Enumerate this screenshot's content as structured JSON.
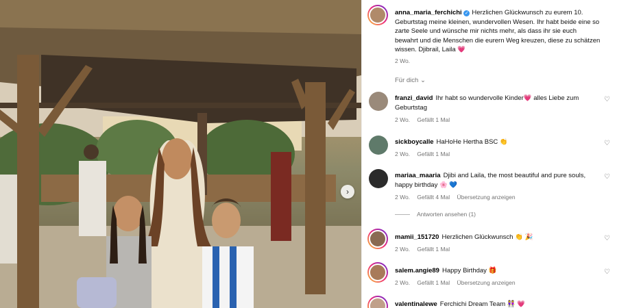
{
  "post": {
    "author": "anna_maria_ferchichi",
    "caption": "Herzlichen Glückwunsch zu eurem 10. Geburtstag meine kleinen, wundervollen Wesen. Ihr habt beide eine so zarte Seele und wünsche mir nichts mehr, als dass ihr sie euch bewahrt und die Menschen die eurern Weg kreuzen, diese zu schätzen wissen. Djibrail, Laila 💗",
    "time": "2 Wo."
  },
  "sort_label": "Für dich",
  "sort_chevron": "⌄",
  "view_replies": "Antworten ansehen (1)",
  "comments": [
    {
      "user": "franzi_david",
      "text": "Ihr habt so wundervolle Kinder💗  alles Liebe zum Geburtstag",
      "time": "2 Wo.",
      "likes": "Gefällt 1 Mal",
      "translate": ""
    },
    {
      "user": "sickboycalle",
      "text": "HaHoHe Hertha BSC 👏",
      "time": "2 Wo.",
      "likes": "Gefällt 1 Mal",
      "translate": ""
    },
    {
      "user": "mariaa_maaria",
      "text": "Djibi and Laila, the most beautiful and pure souls, happy birthday 🌸 💙",
      "time": "2 Wo.",
      "likes": "Gefällt 4 Mal",
      "translate": "Übersetzung anzeigen"
    },
    {
      "user": "mamii_151720",
      "text": "Herzlichen Glückwunsch 👏 🎉",
      "time": "2 Wo.",
      "likes": "Gefällt 1 Mal",
      "translate": ""
    },
    {
      "user": "salem.angie89",
      "text": "Happy Birthday 🎁",
      "time": "2 Wo.",
      "likes": "Gefällt 1 Mal",
      "translate": "Übersetzung anzeigen"
    },
    {
      "user": "valentinalewe",
      "text": "Ferchichi Dream Team 👭 💗",
      "time": "",
      "likes": "",
      "translate": ""
    }
  ],
  "icons": {
    "like": "heart-outline-icon",
    "next": "chevron-right-icon",
    "verified": "verified-badge-icon"
  },
  "colors": {
    "link_gray": "#737373",
    "verified_blue": "#3897f0",
    "ring_gradient_start": "#f9ce34",
    "ring_gradient_end": "#6228d7"
  }
}
